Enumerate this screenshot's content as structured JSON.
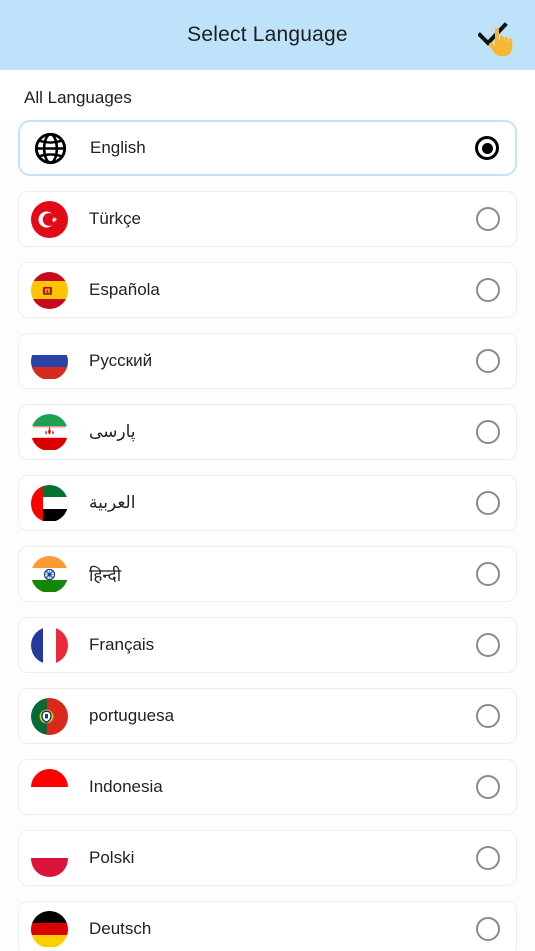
{
  "header": {
    "title": "Select Language",
    "confirm_icon": "check-icon",
    "cursor_icon": "pointing-hand-cursor"
  },
  "section": {
    "label": "All Languages"
  },
  "colors": {
    "appbar_background": "#bfe2fb",
    "selected_border": "#c2e3f8",
    "card_background": "#ffffff",
    "card_border": "#ededed",
    "page_background": "#fdfdfd",
    "text_primary": "#222222",
    "radio_unselected": "#8a8a8a",
    "radio_selected": "#000000"
  },
  "languages": [
    {
      "name": "English",
      "icon": "globe-icon",
      "selected": true,
      "rtl": false
    },
    {
      "name": "Türkçe",
      "icon": "flag-turkey-icon",
      "selected": false,
      "rtl": false
    },
    {
      "name": "Española",
      "icon": "flag-spain-icon",
      "selected": false,
      "rtl": false
    },
    {
      "name": "Русский",
      "icon": "flag-russia-icon",
      "selected": false,
      "rtl": false
    },
    {
      "name": "پارسی",
      "icon": "flag-iran-icon",
      "selected": false,
      "rtl": true
    },
    {
      "name": "العربية",
      "icon": "flag-uae-icon",
      "selected": false,
      "rtl": true
    },
    {
      "name": "हिन्दी",
      "icon": "flag-india-icon",
      "selected": false,
      "rtl": false
    },
    {
      "name": "Français",
      "icon": "flag-france-icon",
      "selected": false,
      "rtl": false
    },
    {
      "name": "portuguesa",
      "icon": "flag-portugal-icon",
      "selected": false,
      "rtl": false
    },
    {
      "name": "Indonesia",
      "icon": "flag-indonesia-icon",
      "selected": false,
      "rtl": false
    },
    {
      "name": "Polski",
      "icon": "flag-poland-icon",
      "selected": false,
      "rtl": false
    },
    {
      "name": "Deutsch",
      "icon": "flag-germany-icon",
      "selected": false,
      "rtl": false
    }
  ]
}
